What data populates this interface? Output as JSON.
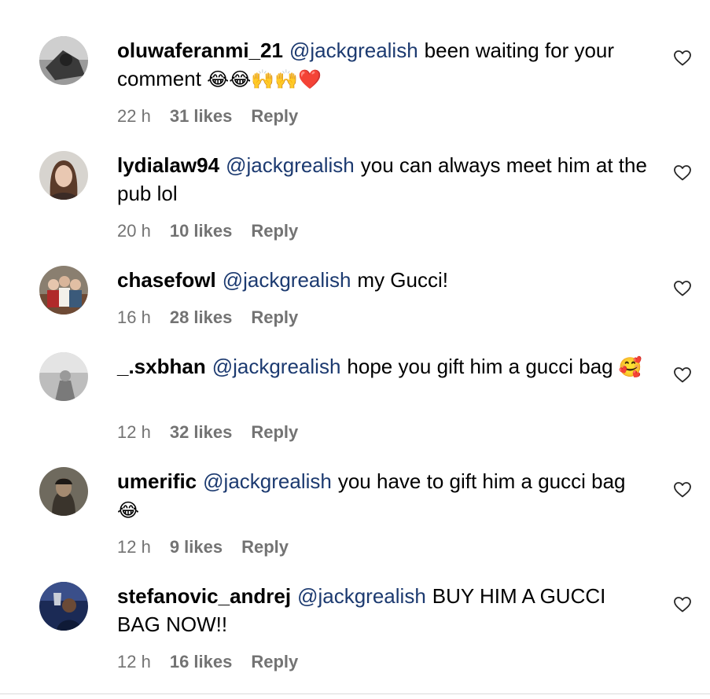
{
  "comments": [
    {
      "username": "oluwaferanmi_21",
      "mention": "@jackgrealish",
      "text": "been waiting for your comment",
      "emoji": "😂😂🙌🙌❤️",
      "time": "22 h",
      "likes": "31 likes",
      "reply": "Reply"
    },
    {
      "username": "lydialaw94",
      "mention": "@jackgrealish",
      "text": "you can always meet him at the pub lol",
      "emoji": "",
      "time": "20 h",
      "likes": "10 likes",
      "reply": "Reply"
    },
    {
      "username": "chasefowl",
      "mention": "@jackgrealish",
      "text": "my Gucci!",
      "emoji": "",
      "time": "16 h",
      "likes": "28 likes",
      "reply": "Reply"
    },
    {
      "username": "_.sxbhan",
      "mention": "@jackgrealish",
      "text": "hope you gift him a gucci bag",
      "emoji": "🥰",
      "time": "12 h",
      "likes": "32 likes",
      "reply": "Reply"
    },
    {
      "username": "umerific",
      "mention": "@jackgrealish",
      "text": "you have to gift him a gucci bag",
      "emoji": "😂",
      "time": "12 h",
      "likes": "9 likes",
      "reply": "Reply"
    },
    {
      "username": "stefanovic_andrej",
      "mention": "@jackgrealish",
      "text": "BUY HIM A GUCCI BAG NOW!!",
      "emoji": "",
      "time": "12 h",
      "likes": "16 likes",
      "reply": "Reply"
    }
  ],
  "icons": {
    "like": "heart-outline-icon"
  }
}
